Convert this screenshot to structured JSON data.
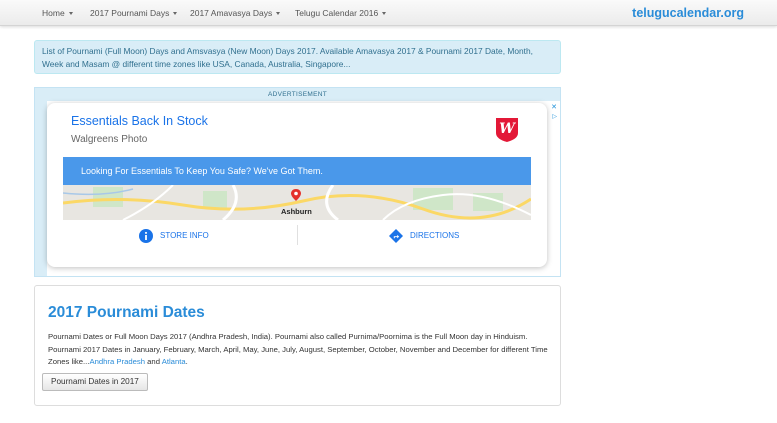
{
  "nav": {
    "items": [
      {
        "label": "Home"
      },
      {
        "label": "2017 Pournami Days"
      },
      {
        "label": "2017 Amavasya Days"
      },
      {
        "label": "Telugu Calendar 2016"
      }
    ],
    "brand": "telugucalendar.org"
  },
  "intro": {
    "text": "List of Pournami (Full Moon) Days and Amsvasya (New Moon) Days 2017. Available Amavasya 2017 & Pournami 2017 Date, Month, Week and Masam @ different time zones like USA, Canada, Australia, Singapore..."
  },
  "ad": {
    "label": "ADVERTISEMENT",
    "close_glyph": "✕",
    "play_glyph": "▷",
    "title": "Essentials Back In Stock",
    "subtitle": "Walgreens Photo",
    "logo_letter": "W",
    "banner": "Looking For Essentials To Keep You Safe? We've Got Them.",
    "map_label": "Ashburn",
    "actions": {
      "store_info": "STORE INFO",
      "directions": "DIRECTIONS"
    },
    "colors": {
      "accent": "#1a73e8",
      "banner": "#4a98ea",
      "logo": "#e31837"
    }
  },
  "panel": {
    "title": "2017 Pournami Dates",
    "body": "Pournami Dates or Full Moon Days 2017 (Andhra Pradesh, India). Pournami also called Purnima/Poornima is the Full Moon day in Hinduism. Pournami 2017 Dates in January, February, March, April, May, June, July, August, September, October, November and December for different Time Zones like...",
    "link1": "Andhra Pradesh",
    "connector": "and",
    "link2": "Atlanta",
    "end": ".",
    "button": "Pournami Dates in 2017"
  },
  "colors": {
    "brand": "#2a8cd8",
    "info_bg": "#d9edf7",
    "info_text": "#31708f"
  }
}
